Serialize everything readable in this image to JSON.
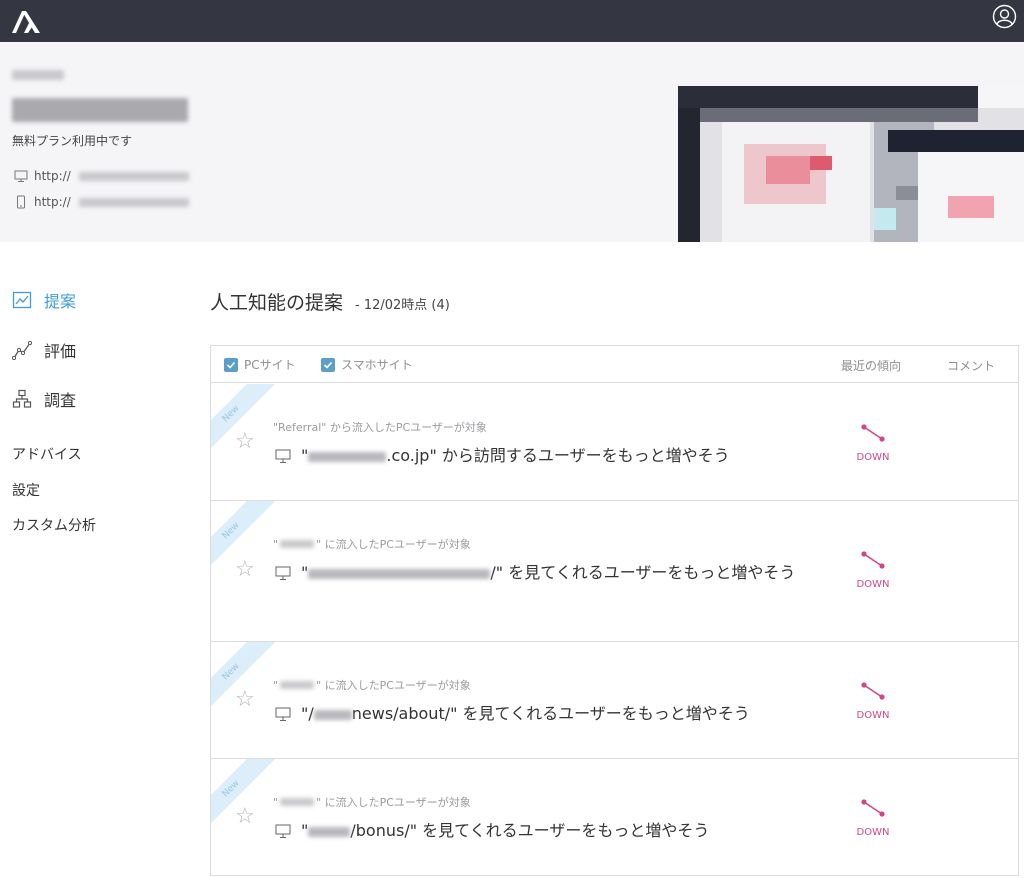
{
  "topbar": {
    "logo": "app-logo",
    "user_icon": "user-icon"
  },
  "profile": {
    "plan": "無料プラン利用中です",
    "pc_url": "http://",
    "sp_url": "http://"
  },
  "sidebar": {
    "nav": [
      {
        "label": "提案",
        "icon": "chart-line-icon",
        "active": true
      },
      {
        "label": "評価",
        "icon": "trend-line-icon",
        "active": false
      },
      {
        "label": "調査",
        "icon": "sitemap-icon",
        "active": false
      }
    ],
    "sub": [
      "アドバイス",
      "設定",
      "カスタム分析"
    ]
  },
  "main": {
    "title": "人工知能の提案",
    "subtitle": "- 12/02時点 (4)"
  },
  "panel": {
    "filters": [
      {
        "label": "PCサイト",
        "checked": true
      },
      {
        "label": "スマホサイト",
        "checked": true
      }
    ],
    "col_trend": "最近の傾向",
    "col_comment": "コメント",
    "items": [
      {
        "badge": "New",
        "target_prefix": "\"Referral\" から流入したPCユーザーが対象",
        "text_prefix": "\"",
        "text_suffix": ".co.jp\" から訪問するユーザーをもっと増やそう",
        "trend": "DOWN"
      },
      {
        "badge": "New",
        "target_prefix": "\"",
        "target_suffix": "\" に流入したPCユーザーが対象",
        "text_prefix": "\"",
        "text_suffix": "/\" を見てくれるユーザーをもっと増やそう",
        "trend": "DOWN"
      },
      {
        "badge": "New",
        "target_prefix": "\"",
        "target_suffix": "\" に流入したPCユーザーが対象",
        "text_prefix": "\"/",
        "text_suffix": "news/about/\" を見てくれるユーザーをもっと増やそう",
        "trend": "DOWN"
      },
      {
        "badge": "New",
        "target_prefix": "\"",
        "target_suffix": "\" に流入したPCユーザーが対象",
        "text_prefix": "\"",
        "text_suffix": "/bonus/\" を見てくれるユーザーをもっと増やそう",
        "trend": "DOWN"
      }
    ]
  },
  "colors": {
    "topbar": "#343741",
    "accent": "#3e9cd6",
    "trend_down": "#d14687",
    "new_ribbon": "#dbeef9"
  }
}
